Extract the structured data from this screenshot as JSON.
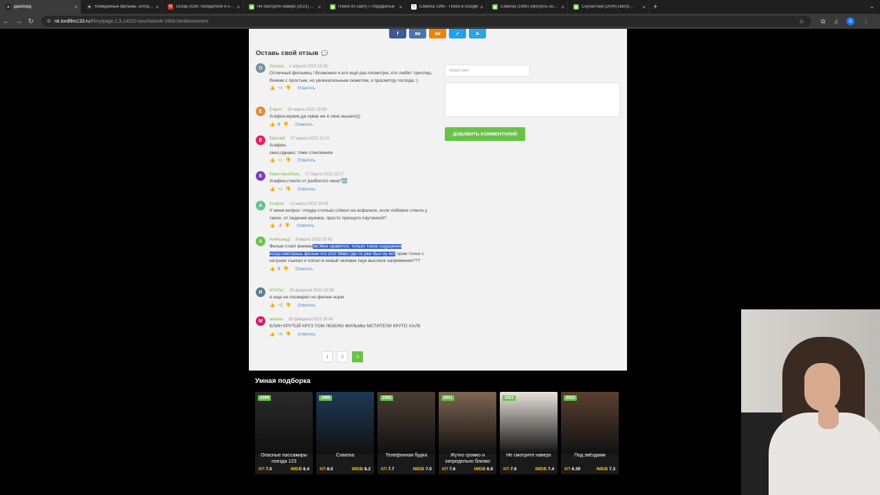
{
  "browser": {
    "tabs": [
      {
        "title": "Дашборд",
        "color": "#202020",
        "glyph": "✕"
      },
      {
        "title": "Комедийные фильмы, которые…",
        "color": "#2b2b2b",
        "glyph": "✦"
      },
      {
        "title": "Оскар-2026: победители и но…",
        "color": "#c0392b",
        "glyph": "N"
      },
      {
        "title": "Не смотрите наверх (2021) см…",
        "color": "#6ac24a",
        "glyph": "▣"
      },
      {
        "title": "Поиск по сайту » Лордфильм",
        "color": "#6ac24a",
        "glyph": "▣"
      },
      {
        "title": "Схватка 1995 - Поиск в Google",
        "color": "#ffffff",
        "glyph": "G"
      },
      {
        "title": "Схватка (1995) смотреть онла…",
        "color": "#6ac24a",
        "glyph": "▣"
      },
      {
        "title": "Соучастник (2004) смотр…",
        "color": "#6ac24a",
        "glyph": "▣"
      }
    ],
    "url_host": "nk.lordfilm133.ru",
    "url_path": "/filmy/page,1,3,14310-souchastnik-2004.html#comment"
  },
  "comments_section": {
    "title": "Оставь свой отзыв",
    "name_placeholder": "Ваше имя",
    "submit_label": "ДОБАВИТЬ КОММЕНТАРИЙ",
    "comments": [
      {
        "initial": "О",
        "color": "#78909c",
        "name": "Оксана",
        "date": "2 апреля 2022 16:35",
        "text": "Отличный фильмец ! Возможно я его ещё раз посмотрю, кто любит триллер, боевик с простым, но увлекательным сюжетом, к просмотру господа :)",
        "score": "+4",
        "score_kind": "pos"
      },
      {
        "initial": "E",
        "color": "#e08a3c",
        "name": "Evgeni",
        "date": "20 марта 2022 19:59",
        "text": "Агафон,мужик,да чувак же в окно вышел)))",
        "score": "0",
        "score_kind": "zero"
      },
      {
        "initial": "Е",
        "color": "#e91e63",
        "name": "Евгений",
        "date": "17 марта 2022 22:31",
        "text_lines": [
          "Агафон,",
          "окно,однако, тоже стеклянное"
        ],
        "score": "+1",
        "score_kind": "pos"
      },
      {
        "initial": "К",
        "color": "#7b3fb5",
        "name": "КвантовыйЗаяц",
        "date": "17 марта 2022 22:17",
        "text": "Агафон,стекло от разбитого окна?🆒",
        "score": "+1",
        "score_kind": "pos"
      },
      {
        "initial": "А",
        "color": "#66c28a",
        "name": "Агафон",
        "date": "13 марта 2022 18:43",
        "text": "У меня вопрос: откуда столько стёкол на асфальте, если лобовое стекло у такси, от падения мужика, просто треснуло паутинкой?",
        "score": "-3",
        "score_kind": "neg"
      },
      {
        "initial": "А",
        "color": "#6ac24a",
        "name": "Александр",
        "date": "9 марта 2022 20:41",
        "text_pre": "Фильм стоит вниман",
        "text_hl1": "ия.Мне нравится, только такое ощущение",
        "text_hl2": "когда смотришь фильм что этот Макс где-то уже был ну вот",
        "text_post1": " прям",
        "text_post2": "точно с катушек съехал и попал в новый человек паук высокое напряжение???",
        "score": "0",
        "score_kind": "zero"
      },
      {
        "initial": "И",
        "color": "#607d8b",
        "name": "ИГАРЬ!",
        "date": "25 февраля 2022 20:39",
        "text": "я еще не посмарел но фильм норм",
        "score": "+5",
        "score_kind": "pos"
      },
      {
        "initial": "М",
        "color": "#d81b60",
        "name": "магина",
        "date": "25 февраля 2022 20:40",
        "text": "БЛИН КРУТОЙ КРУЗ ТОМ ЛЮБЛЮ ФИЛЬМЫ МСТИТЕЛИ КРУТО ХАЛК",
        "score": "+6",
        "score_kind": "pos"
      }
    ],
    "reply_label": "Ответить",
    "pages": [
      "1",
      "2",
      "3"
    ],
    "current_page": "3"
  },
  "smart": {
    "title": "Умная подборка",
    "posters": [
      {
        "year": "2009",
        "title": "Опасные пассажиры поезда 123",
        "kp": "7.0",
        "imdb": "6.4",
        "bg": "#2b2a2a"
      },
      {
        "year": "1995",
        "title": "Схватка",
        "kp": "8.0",
        "imdb": "8.2",
        "bg": "#1d3a56"
      },
      {
        "year": "2002",
        "title": "Телефонная будка",
        "kp": "7.7",
        "imdb": "7.0",
        "bg": "#4b3d33"
      },
      {
        "year": "2011",
        "title": "Жутко громко и запредельно близко",
        "kp": "7.6",
        "imdb": "6.9",
        "bg": "#7e6651"
      },
      {
        "year": "2021",
        "title": "Не смотрите наверх",
        "kp": "7.6",
        "imdb": "7.4",
        "bg": "#e9e3dc"
      },
      {
        "year": "2023",
        "title": "Под звёздами",
        "kp": "6.39",
        "imdb": "7.3",
        "bg": "#5a4030"
      }
    ]
  },
  "labels": {
    "kp": "КП",
    "imdb": "IMDB"
  }
}
